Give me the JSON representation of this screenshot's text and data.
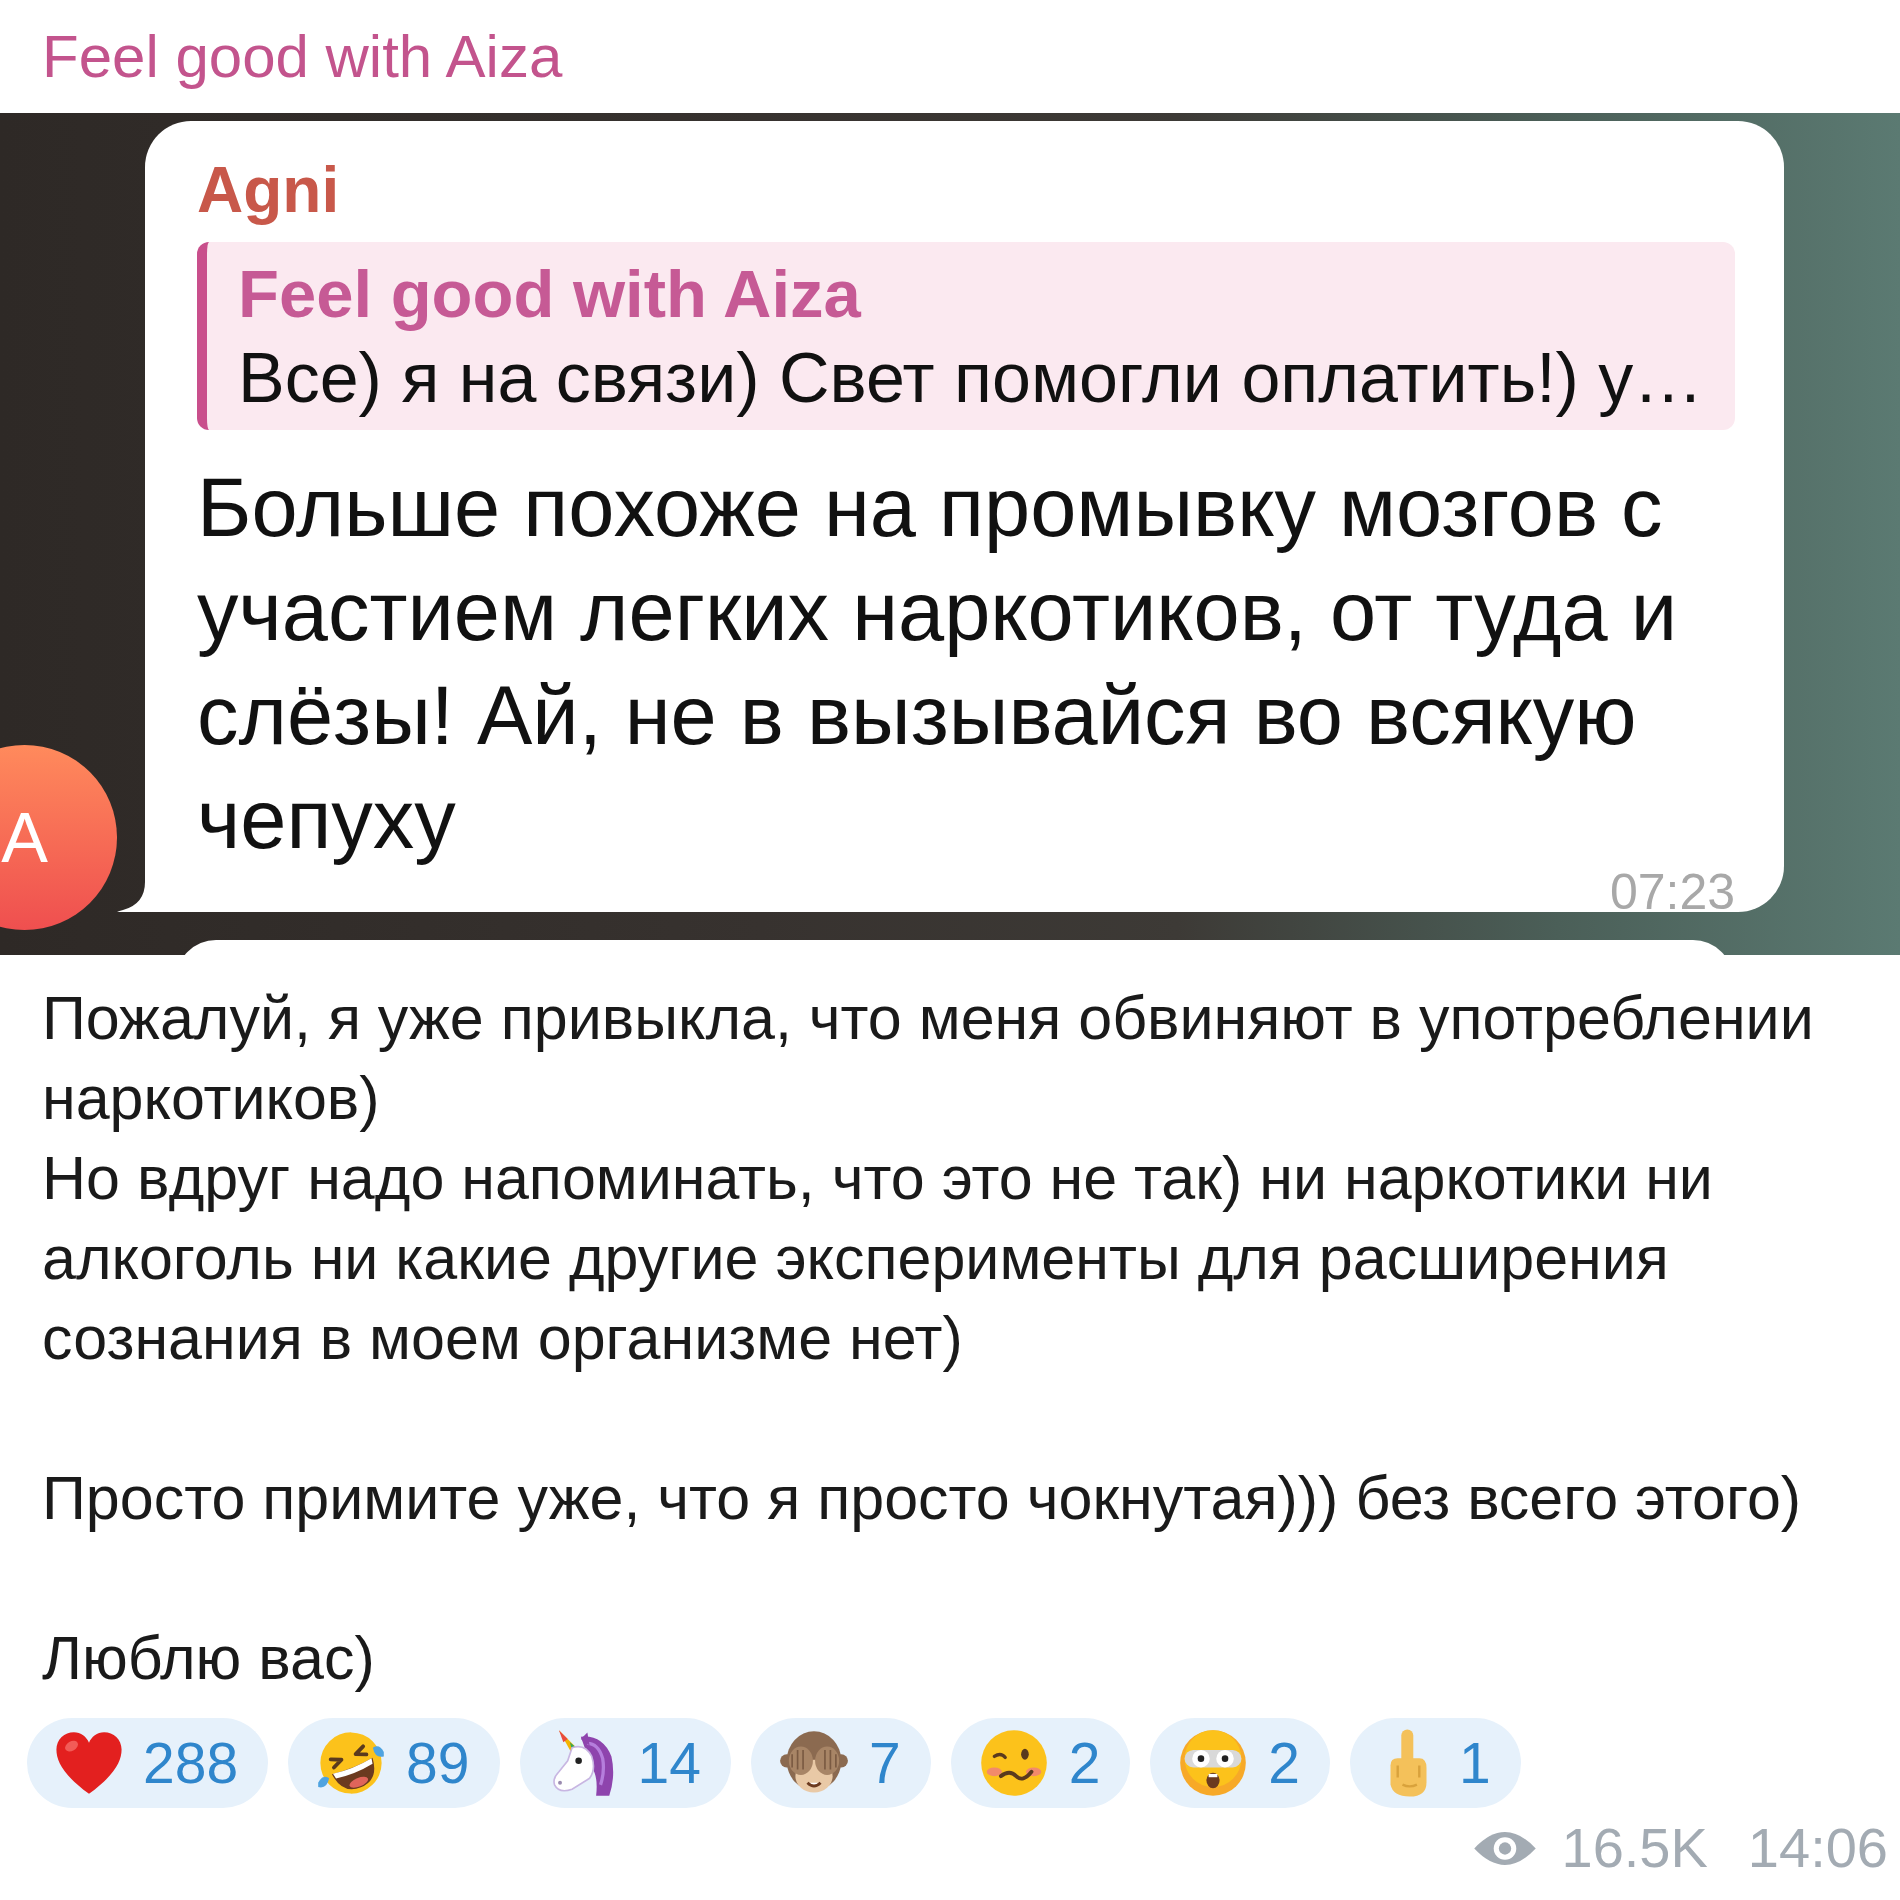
{
  "channel": {
    "title": "Feel good with Aiza"
  },
  "screenshot": {
    "avatar": {
      "initial": "A"
    },
    "message": {
      "sender": "Agni",
      "reply": {
        "author": "Feel good with Aiza",
        "text": "Все) я на связи) Свет помогли оплатить!) у…"
      },
      "text": "Больше похоже на промывку мозгов с участием легких наркотиков, от туда и слёзы! Ай, не в вызывайся во всякую чепуху",
      "time": "07:23"
    }
  },
  "post": {
    "text": "Пожалуй, я уже привыкла, что меня обвиняют в употреблении наркотиков)\nНо вдруг надо напоминать, что это не так) ни наркотики ни алкоголь ни какие другие эксперименты для расширения сознания в моем организме нет)\n\nПросто примите уже, что я просто чокнутая))) без всего этого)\n\nЛюблю вас)"
  },
  "reactions": [
    {
      "kind": "heart",
      "count": "288"
    },
    {
      "kind": "laughing",
      "count": "89"
    },
    {
      "kind": "unicorn",
      "count": "14"
    },
    {
      "kind": "monkey",
      "count": "7"
    },
    {
      "kind": "woozy",
      "count": "2"
    },
    {
      "kind": "shocked",
      "count": "2"
    },
    {
      "kind": "finger",
      "count": "1"
    }
  ],
  "footer": {
    "views": "16.5K",
    "time": "14:06"
  }
}
